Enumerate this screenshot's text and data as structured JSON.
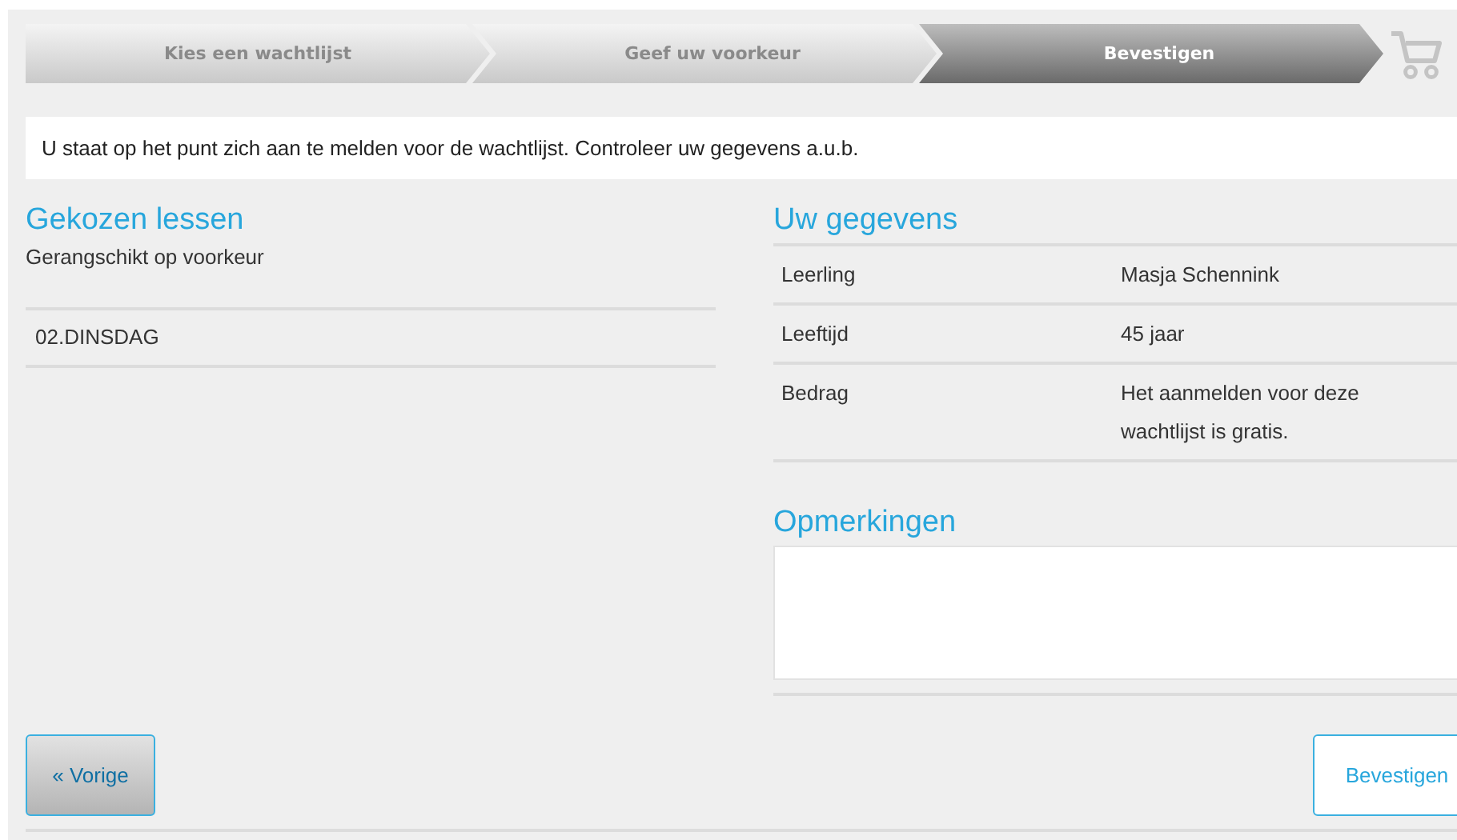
{
  "steps": [
    {
      "label": "Kies een wachtlijst",
      "selected": false
    },
    {
      "label": "Geef uw voorkeur",
      "selected": false
    },
    {
      "label": "Bevestigen",
      "selected": true
    }
  ],
  "message": "U staat op het punt zich aan te melden voor de wachtlijst. Controleer uw gegevens a.u.b.",
  "chosen": {
    "title": "Gekozen lessen",
    "subtitle": "Gerangschikt op voorkeur",
    "lessons": [
      "02.DINSDAG"
    ]
  },
  "details": {
    "title": "Uw gegevens",
    "rows": [
      {
        "label": "Leerling",
        "value": "Masja Schennink"
      },
      {
        "label": "Leeftijd",
        "value": "45 jaar"
      },
      {
        "label": "Bedrag",
        "value": "Het aanmelden voor deze wachtlijst is gratis."
      }
    ]
  },
  "remarks": {
    "title": "Opmerkingen"
  },
  "buttons": {
    "back": "« Vorige",
    "confirm": "Bevestigen"
  }
}
